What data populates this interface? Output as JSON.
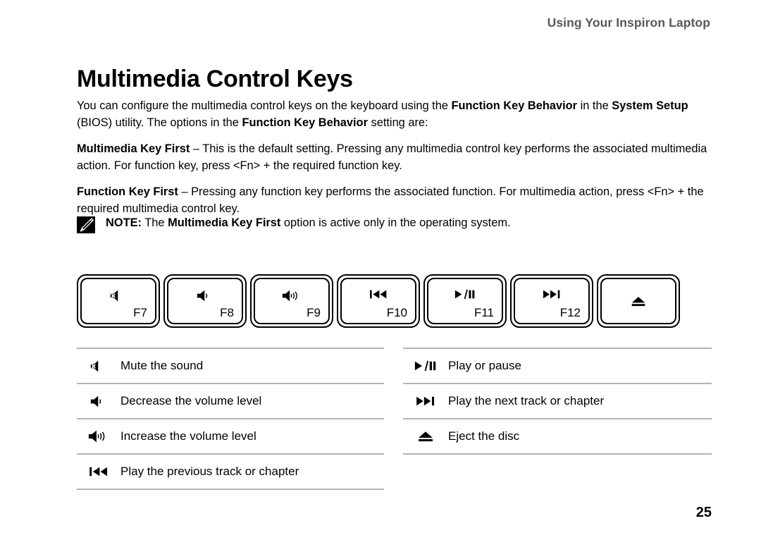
{
  "header": {
    "running_title": "Using Your Inspiron Laptop"
  },
  "heading": {
    "title": "Multimedia Control Keys"
  },
  "paragraphs": {
    "intro_part1": "You can configure the multimedia control keys on the keyboard using the ",
    "intro_bold1": "Function Key Behavior",
    "intro_part2": " in the ",
    "intro_bold2": "System Setup",
    "intro_part3": " (BIOS) utility. The options in the ",
    "intro_bold3": "Function Key Behavior",
    "intro_part4": " setting are:",
    "mmkey_bold": "Multimedia Key First",
    "mmkey_text": " – This is the default setting. Pressing any multimedia control key performs the associated multimedia action. For function key, press <Fn> + the required function key.",
    "fnkey_bold": "Function Key First",
    "fnkey_text": " – Pressing any function key performs the associated function. For multimedia action, press <Fn> + the required multimedia control key."
  },
  "note": {
    "icon": "note-pencil-icon",
    "label": "NOTE:",
    "text_part1": " The ",
    "bold": "Multimedia Key First",
    "text_part2": " option is active only in the operating system."
  },
  "keys": [
    {
      "icon": "mute-icon",
      "label": "F7"
    },
    {
      "icon": "volume-down-icon",
      "label": "F8"
    },
    {
      "icon": "volume-up-icon",
      "label": "F9"
    },
    {
      "icon": "previous-track-icon",
      "label": "F10"
    },
    {
      "icon": "play-pause-icon",
      "label": "F11"
    },
    {
      "icon": "next-track-icon",
      "label": "F12"
    },
    {
      "icon": "eject-icon",
      "label": ""
    }
  ],
  "legend_left": [
    {
      "icon": "mute-icon",
      "text": "Mute the sound"
    },
    {
      "icon": "volume-down-icon",
      "text": "Decrease the volume level"
    },
    {
      "icon": "volume-up-icon",
      "text": "Increase the volume level"
    },
    {
      "icon": "previous-track-icon",
      "text": "Play the previous track or chapter"
    }
  ],
  "legend_right": [
    {
      "icon": "play-pause-icon",
      "text": "Play or pause"
    },
    {
      "icon": "next-track-icon",
      "text": "Play the next track or chapter"
    },
    {
      "icon": "eject-icon",
      "text": "Eject the disc"
    }
  ],
  "footer": {
    "page_number": "25"
  },
  "colors": {
    "header_gray": "#58585a",
    "rule_gray": "#b3b3b3",
    "text_black": "#000000",
    "page_background": "#ffffff"
  }
}
